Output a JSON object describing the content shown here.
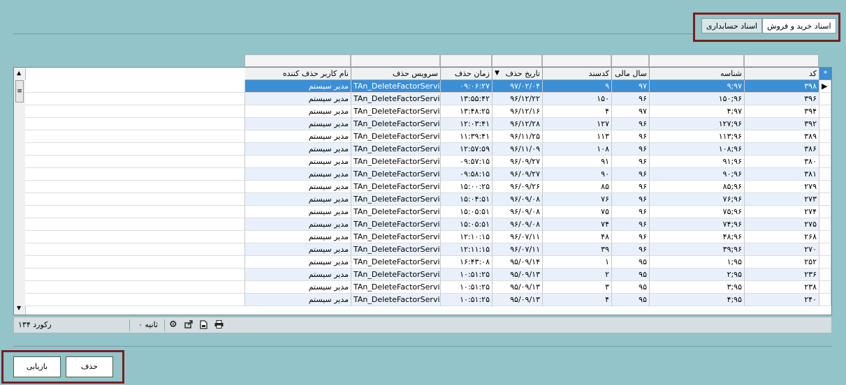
{
  "tabs": [
    "اسناد خرید و فروش",
    "اسناد حسابداری"
  ],
  "columns": {
    "code": "کد",
    "id": "شناسه",
    "fiscal_year": "سال مالی",
    "doc_code": "کدسند",
    "delete_date": "تاریخ حذف",
    "delete_time": "زمان حذف",
    "service": "سرویس حذف",
    "user": "نام کاربر حذف کننده"
  },
  "rows": [
    {
      "code": "۳۹۸",
      "id": "۹;۹۷",
      "year": "۹۷",
      "doc": "۹",
      "date": "۹۷/۰۲/۰۴",
      "time": "۰۹:۰۶:۲۷",
      "service": "TAn_DeleteFactorService",
      "user": "مدیر سیستم"
    },
    {
      "code": "۳۹۶",
      "id": "۱۵۰;۹۶",
      "year": "۹۶",
      "doc": "۱۵۰",
      "date": "۹۶/۱۲/۲۲",
      "time": "۱۳:۵۵:۴۲",
      "service": "TAn_DeleteFactorService",
      "user": "مدیر سیستم"
    },
    {
      "code": "۳۹۴",
      "id": "۴;۹۷",
      "year": "۹۷",
      "doc": "۴",
      "date": "۹۶/۱۲/۱۶",
      "time": "۱۳:۴۸:۲۵",
      "service": "TAn_DeleteFactorService",
      "user": "مدیر سیستم"
    },
    {
      "code": "۳۹۲",
      "id": "۱۲۷;۹۶",
      "year": "۹۶",
      "doc": "۱۲۷",
      "date": "۹۶/۱۲/۲۸",
      "time": "۱۲:۰۳:۴۱",
      "service": "TAn_DeleteFactorService",
      "user": "مدیر سیستم"
    },
    {
      "code": "۳۸۹",
      "id": "۱۱۳;۹۶",
      "year": "۹۶",
      "doc": "۱۱۳",
      "date": "۹۶/۱۱/۲۵",
      "time": "۱۱:۳۹:۴۱",
      "service": "TAn_DeleteFactorService",
      "user": "مدیر سیستم"
    },
    {
      "code": "۳۸۶",
      "id": "۱۰۸;۹۶",
      "year": "۹۶",
      "doc": "۱۰۸",
      "date": "۹۶/۱۱/۰۹",
      "time": "۱۲:۵۷:۵۹",
      "service": "TAn_DeleteFactorService",
      "user": "مدیر سیستم"
    },
    {
      "code": "۳۸۰",
      "id": "۹۱;۹۶",
      "year": "۹۶",
      "doc": "۹۱",
      "date": "۹۶/۰۹/۲۷",
      "time": "۰۹:۵۷:۱۵",
      "service": "TAn_DeleteFactorService",
      "user": "مدیر سیستم"
    },
    {
      "code": "۳۸۱",
      "id": "۹۰;۹۶",
      "year": "۹۶",
      "doc": "۹۰",
      "date": "۹۶/۰۹/۲۷",
      "time": "۰۹:۵۸:۱۵",
      "service": "TAn_DeleteFactorService",
      "user": "مدیر سیستم"
    },
    {
      "code": "۲۷۹",
      "id": "۸۵;۹۶",
      "year": "۹۶",
      "doc": "۸۵",
      "date": "۹۶/۰۹/۲۶",
      "time": "۱۵:۰۰:۲۵",
      "service": "TAn_DeleteFactorService",
      "user": "مدیر سیستم"
    },
    {
      "code": "۲۷۳",
      "id": "۷۶;۹۶",
      "year": "۹۶",
      "doc": "۷۶",
      "date": "۹۶/۰۹/۰۸",
      "time": "۱۵:۰۴:۵۱",
      "service": "TAn_DeleteFactorService",
      "user": "مدیر سیستم"
    },
    {
      "code": "۲۷۴",
      "id": "۷۵;۹۶",
      "year": "۹۶",
      "doc": "۷۵",
      "date": "۹۶/۰۹/۰۸",
      "time": "۱۵:۰۵:۵۱",
      "service": "TAn_DeleteFactorService",
      "user": "مدیر سیستم"
    },
    {
      "code": "۲۷۵",
      "id": "۷۴;۹۶",
      "year": "۹۶",
      "doc": "۷۴",
      "date": "۹۶/۰۹/۰۸",
      "time": "۱۵:۰۵:۵۱",
      "service": "TAn_DeleteFactorService",
      "user": "مدیر سیستم"
    },
    {
      "code": "۲۶۸",
      "id": "۴۸;۹۶",
      "year": "۹۶",
      "doc": "۴۸",
      "date": "۹۶/۰۷/۱۱",
      "time": "۱۲:۱۰:۱۵",
      "service": "TAn_DeleteFactorService",
      "user": "مدیر سیستم"
    },
    {
      "code": "۲۷۰",
      "id": "۳۹;۹۶",
      "year": "۹۶",
      "doc": "۳۹",
      "date": "۹۶/۰۷/۱۱",
      "time": "۱۲:۱۱:۱۵",
      "service": "TAn_DeleteFactorService",
      "user": "مدیر سیستم"
    },
    {
      "code": "۲۵۲",
      "id": "۱;۹۵",
      "year": "۹۵",
      "doc": "۱",
      "date": "۹۵/۰۹/۱۴",
      "time": "۱۶:۴۳:۰۸",
      "service": "TAn_DeleteFactorService",
      "user": "مدیر سیستم"
    },
    {
      "code": "۲۳۶",
      "id": "۲;۹۵",
      "year": "۹۵",
      "doc": "۲",
      "date": "۹۵/۰۹/۱۳",
      "time": "۱۰:۵۱:۲۵",
      "service": "TAn_DeleteFactorService",
      "user": "مدیر سیستم"
    },
    {
      "code": "۲۳۸",
      "id": "۳;۹۵",
      "year": "۹۵",
      "doc": "۳",
      "date": "۹۵/۰۹/۱۳",
      "time": "۱۰:۵۱:۲۵",
      "service": "TAn_DeleteFactorService",
      "user": "مدیر سیستم"
    },
    {
      "code": "۲۴۰",
      "id": "۴;۹۵",
      "year": "۹۵",
      "doc": "۴",
      "date": "۹۵/۰۹/۱۳",
      "time": "۱۰:۵۱:۲۵",
      "service": "TAn_DeleteFactorService",
      "user": "مدیر سیستم"
    }
  ],
  "status": {
    "record_count": "۱۳۴ رکورد",
    "seconds": "۰ ثانیه"
  },
  "buttons": {
    "delete": "حذف",
    "restore": "بازیابی"
  },
  "icons": [
    "print-icon",
    "export-pdf-icon",
    "export-icon",
    "settings-icon"
  ]
}
